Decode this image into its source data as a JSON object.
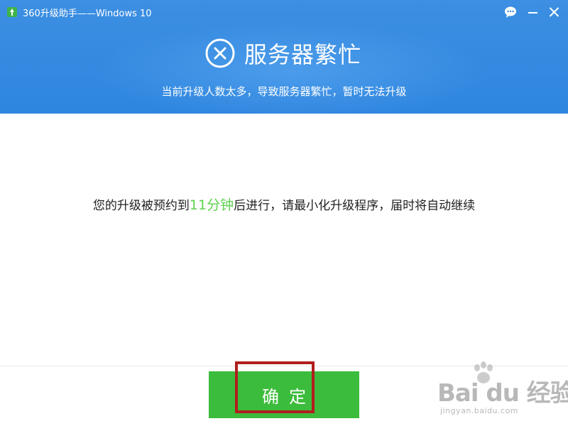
{
  "window": {
    "title": "360升级助手——Windows 10",
    "icons": {
      "app": "upgrade-arrow-icon",
      "chat": "chat-bubble-icon",
      "minimize": "minimize-icon",
      "close": "close-icon"
    }
  },
  "header": {
    "status_icon": "circle-x-icon",
    "status_title": "服务器繁忙",
    "subtitle": "当前升级人数太多，导致服务器繁忙，暂时无法升级",
    "bg_color": "#2f86df"
  },
  "message": {
    "prefix": "您的升级被预约到",
    "highlight": "11分钟",
    "suffix": "后进行，请最小化升级程序，届时将自动继续",
    "highlight_color": "#5fd14f"
  },
  "footer": {
    "confirm_label": "确定",
    "confirm_color": "#3cbc3c",
    "annotation_color": "#b21e1e"
  },
  "watermark": {
    "brand": "Bai du 经验",
    "url": "jingyan.baidu.com"
  }
}
